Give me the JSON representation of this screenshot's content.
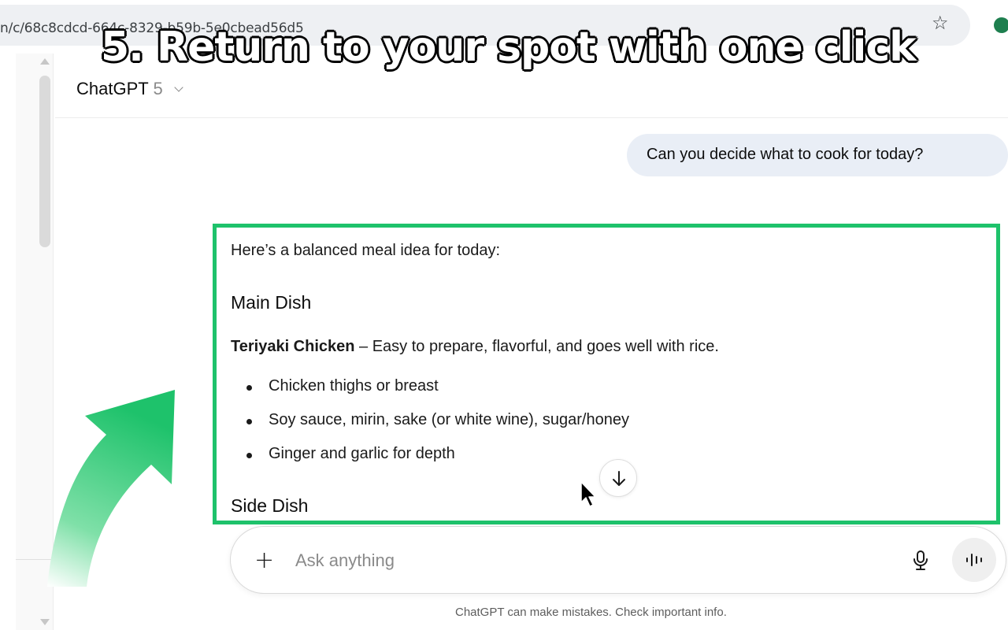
{
  "browser": {
    "url": "n/c/68c8cdcd-664c-8329-b59b-5e0cbead56d5",
    "bookmark_icon": "star-icon",
    "extension_icon": "extension-icon"
  },
  "caption": "5. Return to your spot with one click",
  "header": {
    "model_name": "ChatGPT",
    "model_version": "5"
  },
  "conversation": {
    "user_message": "Can you decide what to cook for today?",
    "response": {
      "intro": "Here’s a balanced meal idea for today:",
      "main_heading": "Main Dish",
      "dish_name": "Teriyaki Chicken",
      "dish_description": " – Easy to prepare, flavorful, and goes well with rice.",
      "bullets": [
        "Chicken thighs or breast",
        "Soy sauce, mirin, sake (or white wine), sugar/honey",
        "Ginger and garlic for depth"
      ],
      "side_heading": "Side Dish"
    }
  },
  "composer": {
    "placeholder": "Ask anything"
  },
  "disclaimer": "ChatGPT can make mistakes. Check important info.",
  "colors": {
    "highlight": "#1ec26b",
    "user_bubble": "#e9eef6",
    "arrow_start": "#1ec26b",
    "arrow_end": "#ffffff"
  }
}
